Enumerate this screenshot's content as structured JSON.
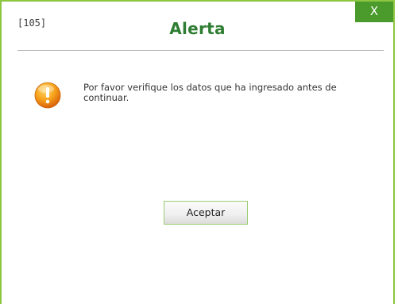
{
  "dialog": {
    "code": "[105]",
    "title": "Alerta",
    "close_label": "X",
    "message": "Por favor verifique los datos que ha ingresado antes de continuar.",
    "icon": "warning-icon",
    "accept_label": "Aceptar"
  },
  "colors": {
    "border": "#8dc63f",
    "title": "#2e7d32",
    "close_bg": "#4a9a2c",
    "warning_icon": "#f39c12"
  }
}
